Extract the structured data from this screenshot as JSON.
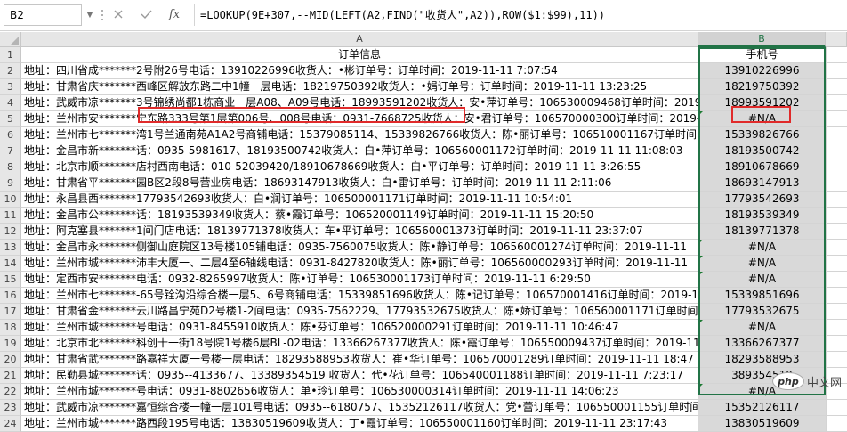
{
  "formula_bar": {
    "name_box": "B2",
    "cancel_icon": "close-icon",
    "enter_icon": "check-icon",
    "fx_label": "fx",
    "formula": "=LOOKUP(9E+307,--MID(LEFT(A2,FIND(\"收货人\",A2)),ROW($1:$99),11))"
  },
  "columns": [
    {
      "label": ""
    },
    {
      "label": "A"
    },
    {
      "label": "B"
    },
    {
      "label": ""
    }
  ],
  "row_numbers": [
    "1",
    "2",
    "3",
    "4",
    "5",
    "6",
    "7",
    "8",
    "9",
    "10",
    "11",
    "12",
    "13",
    "14",
    "15",
    "16",
    "17",
    "18",
    "19",
    "20",
    "21",
    "22",
    "23",
    "24"
  ],
  "header": {
    "a": "订单信息",
    "b": "手机号"
  },
  "rows": [
    {
      "a": "地址：四川省成*******2号附26号电话：13910226996收货人：•彬订单号：订单时间：2019-11-11 7:07:54",
      "b": "13910226996",
      "err": false
    },
    {
      "a": "地址：甘肃省庆*******西峰区解放东路二中1幢一层电话：18219750392收货人：•娟订单号：订单时间：2019-11-11 13:23:25",
      "b": "18219750392",
      "err": false
    },
    {
      "a": "地址：武威市凉*******3号锦绣尚都1栋商业一层A08、A09号电话：18993591202收货人：安•萍订单号：106530009468订单时间：2019-11-11",
      "b": "18993591202",
      "err": false
    },
    {
      "a": "地址：兰州市安*******宁东路333号第1层第006号、008号电话：0931-7668725收货人：安•君订单号：106570000300订单时间：2019-11-11",
      "b": "#N/A",
      "err": true
    },
    {
      "a": "地址：兰州市七*******湾1号兰通南苑A1A2号商铺电话：15379085114、15339826766收货人：陈•丽订单号：106510001167订单时间",
      "b": "15339826766",
      "err": false
    },
    {
      "a": "地址：金昌市新*******话：0935-5981617、18193500742收货人：白•萍订单号：106560001172订单时间：2019-11-11 11:08:03",
      "b": "18193500742",
      "err": false
    },
    {
      "a": "地址：北京市顺*******店村西南电话：010-52039420/18910678669收货人：白•平订单号：订单时间：2019-11-11 3:26:55",
      "b": "18910678669",
      "err": false
    },
    {
      "a": "地址：甘肃省平*******园B区2段8号营业房电话：18693147913收货人：白•雷订单号：订单时间：2019-11-11 2:11:06",
      "b": "18693147913",
      "err": false
    },
    {
      "a": "地址：永昌县西*******17793542693收货人：白•润订单号：106500001171订单时间：2019-11-11 10:54:01",
      "b": "17793542693",
      "err": false
    },
    {
      "a": "地址：金昌市公*******话：18193539349收货人：蔡•霞订单号：106520001149订单时间：2019-11-11 15:20:50",
      "b": "18193539349",
      "err": false
    },
    {
      "a": "地址：阿克塞县*******1间门店电话：18139771378收货人：车•平订单号：106560001373订单时间：2019-11-11 23:37:07",
      "b": "18139771378",
      "err": false
    },
    {
      "a": "地址：金昌市永*******侧御山庭院区13号楼105铺电话：0935-7560075收货人：陈•静订单号：106560001274订单时间：2019-11-11",
      "b": "#N/A",
      "err": true
    },
    {
      "a": "地址：兰州市城*******沛丰大厦一、二层4至6轴线电话：0931-8427820收货人：陈•丽订单号：106560000293订单时间：2019-11-11",
      "b": "#N/A",
      "err": true
    },
    {
      "a": "地址：定西市安*******电话：0932-8265997收货人：陈•订单号：106530001173订单时间：2019-11-11 6:29:50",
      "b": "#N/A",
      "err": true
    },
    {
      "a": "地址：兰州市七*******-65号铨沟沿综合楼一层5、6号商铺电话：15339851696收货人：陈•记订单号：106570001416订单时间：2019-11",
      "b": "15339851696",
      "err": false
    },
    {
      "a": "地址：甘肃省金*******云川路昌宁苑D2号楼1-2间电话：0935-7562229、17793532675收货人：陈•娇订单号：106560001171订单时间",
      "b": "17793532675",
      "err": false
    },
    {
      "a": "地址：兰州市城*******号电话：0931-8455910收货人：陈•芬订单号：106520000291订单时间：2019-11-11 10:46:47",
      "b": "#N/A",
      "err": true
    },
    {
      "a": "地址：北京市北*******科创十一街18号院1号楼6层BL-02电话：13366267377收货人：陈•霞订单号：106550009437订单时间：2019-11-11",
      "b": "13366267377",
      "err": false
    },
    {
      "a": "地址：甘肃省武*******路嘉祥大厦一号楼一层电话：18293588953收货人：崔•华订单号：106570001289订单时间：2019-11-11 18:47",
      "b": "18293588953",
      "err": false
    },
    {
      "a": "地址：民勤县城*******话：0935--4133677、13389354519 收货人：代•花订单号：106540001188订单时间：2019-11-11 7:23:17",
      "b": "389354519",
      "err": false
    },
    {
      "a": "地址：兰州市城*******号电话：0931-8802656收货人：单•玲订单号：106530000314订单时间：2019-11-11 14:06:23",
      "b": "#N/A",
      "err": true
    },
    {
      "a": "地址：武威市凉*******嘉恒综合楼一幢一层101号电话：0935--6180757、15352126117收货人：党•蕾订单号：106550001155订单时间",
      "b": "15352126117",
      "err": false
    },
    {
      "a": "地址：兰州市城*******路西段195号电话：13830519609收货人：丁•霞订单号：106550001160订单时间：2019-11-11 23:17:43",
      "b": "13830519609",
      "err": false
    }
  ],
  "watermark": {
    "logo": "php",
    "text": "中文网"
  }
}
